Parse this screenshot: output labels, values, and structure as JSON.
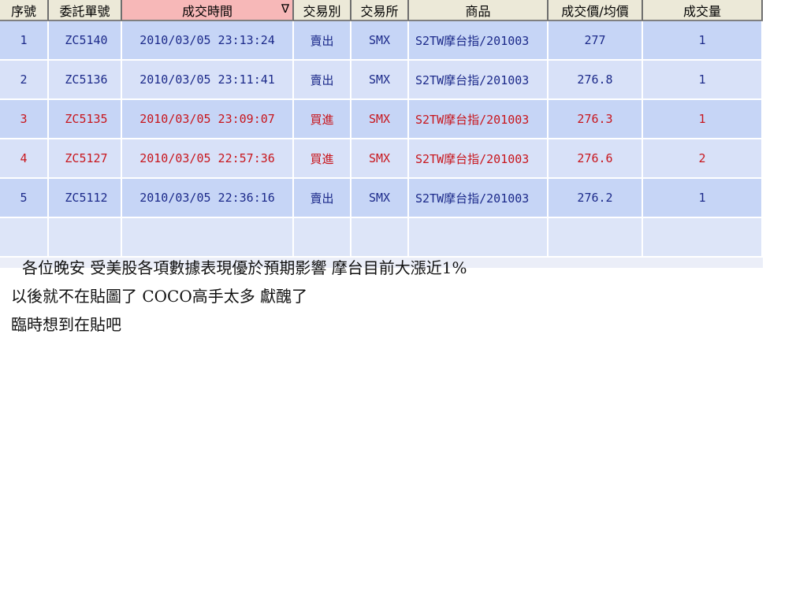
{
  "trade_table": {
    "columns": [
      "序號",
      "委託單號",
      "成交時間",
      "交易別",
      "交易所",
      "商品",
      "成交價/均價",
      "成交量"
    ],
    "sort_indicator": "∇",
    "rows": [
      {
        "seq": "1",
        "order_no": "ZC5140",
        "time": "2010/03/05 23:13:24",
        "side": "賣出",
        "exchange": "SMX",
        "product": "S2TW摩台指/201003",
        "price": "277",
        "qty": "1",
        "side_color": "#1c2a8a"
      },
      {
        "seq": "2",
        "order_no": "ZC5136",
        "time": "2010/03/05 23:11:41",
        "side": "賣出",
        "exchange": "SMX",
        "product": "S2TW摩台指/201003",
        "price": "276.8",
        "qty": "1",
        "side_color": "#1c2a8a"
      },
      {
        "seq": "3",
        "order_no": "ZC5135",
        "time": "2010/03/05 23:09:07",
        "side": "買進",
        "exchange": "SMX",
        "product": "S2TW摩台指/201003",
        "price": "276.3",
        "qty": "1",
        "side_color": "#c8161d"
      },
      {
        "seq": "4",
        "order_no": "ZC5127",
        "time": "2010/03/05 22:57:36",
        "side": "買進",
        "exchange": "SMX",
        "product": "S2TW摩台指/201003",
        "price": "276.6",
        "qty": "2",
        "side_color": "#c8161d"
      },
      {
        "seq": "5",
        "order_no": "ZC5112",
        "time": "2010/03/05 22:36:16",
        "side": "賣出",
        "exchange": "SMX",
        "product": "S2TW摩台指/201003",
        "price": "276.2",
        "qty": "1",
        "side_color": "#1c2a8a"
      }
    ]
  },
  "message": {
    "line1": "各位晚安  受美股各項數據表現優於預期影響    摩台目前大漲近1%",
    "line2": "以後就不在貼圖了  COCO高手太多  獻醜了",
    "line3": "臨時想到在貼吧"
  },
  "colors": {
    "header_bg": "#ece9d8",
    "sorted_header_bg": "#f7b8b8",
    "row_bg_a": "#c6d5f6",
    "row_bg_b": "#d8e1f8",
    "sell_text": "#1c2a8a",
    "buy_text": "#c8161d"
  }
}
